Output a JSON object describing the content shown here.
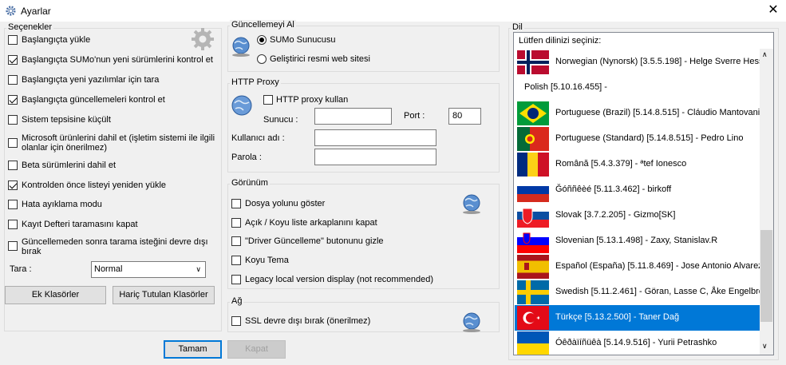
{
  "window": {
    "title": "Ayarlar",
    "close": "✕"
  },
  "options": {
    "label": "Seçenekler",
    "items": [
      {
        "text": "Başlangıçta yükle",
        "checked": false
      },
      {
        "text": "Başlangıçta SUMo'nun yeni sürümlerini kontrol et",
        "checked": true
      },
      {
        "text": "Başlangıçta yeni yazılımlar için tara",
        "checked": false
      },
      {
        "text": "Başlangıçta güncellemeleri kontrol et",
        "checked": true
      },
      {
        "text": "Sistem tepsisine küçült",
        "checked": false
      },
      {
        "text": "Microsoft ürünlerini dahil et (işletim sistemi ile ilgili",
        "text2": "olanlar için önerilmez)",
        "checked": false
      },
      {
        "text": "Beta sürümlerini dahil et",
        "checked": false
      },
      {
        "text": "Kontrolden önce listeyi yeniden yükle",
        "checked": true
      },
      {
        "text": "Hata ayıklama modu",
        "checked": false
      },
      {
        "text": "Kayıt Defteri taramasını kapat",
        "checked": false
      },
      {
        "text": "Güncellemeden sonra tarama isteğini devre dışı",
        "text2": "bırak",
        "checked": false
      }
    ],
    "scan_label": "Tara :",
    "scan_value": "Normal",
    "extra_folders_button": "Ek Klasörler",
    "excluded_folders_button": "Hariç Tutulan Klasörler"
  },
  "update_from": {
    "label": "Güncellemeyi Al",
    "radio1": "SUMo Sunucusu",
    "radio2": "Geliştirici resmi web sitesi"
  },
  "proxy": {
    "label": "HTTP Proxy",
    "use_label": "HTTP proxy kullan",
    "server_label": "Sunucu :",
    "server_value": "",
    "port_label": "Port :",
    "port_value": "80",
    "user_label": "Kullanıcı adı :",
    "user_value": "",
    "pass_label": "Parola :",
    "pass_value": ""
  },
  "appearance": {
    "label": "Görünüm",
    "items": [
      "Dosya yolunu göster",
      "Açık / Koyu liste arkaplanını kapat",
      "\"Driver Güncelleme\" butonunu gizle",
      "Koyu Tema",
      "Legacy local version display (not recommended)"
    ]
  },
  "network": {
    "label": "Ağ",
    "ssl": "SSL devre dışı bırak (önerilmez)"
  },
  "language": {
    "label": "Dil",
    "header": "Lütfen dilinizi seçiniz:",
    "items": [
      {
        "text": "Norwegian (Nynorsk) [3.5.5.198] - Helge Sverre Hessestrand",
        "flag": "norway"
      },
      {
        "text": "Polish [5.10.16.455] -",
        "flag": "none"
      },
      {
        "text": "Portuguese (Brazil) [5.14.8.515] - Cláudio Mantovani V",
        "flag": "brazil"
      },
      {
        "text": "Portuguese (Standard) [5.14.8.515] - Pedro Lino",
        "flag": "portugal"
      },
      {
        "text": "Română [5.4.3.379] - ªtef Ionesco",
        "flag": "romania"
      },
      {
        "text": "Ğóññêèé [5.11.3.462] - birkoff",
        "flag": "russia"
      },
      {
        "text": "Slovak [3.7.2.205] - Gizmo[SK]",
        "flag": "slovakia"
      },
      {
        "text": "Slovenian [5.13.1.498] - Zaxy, Stanislav.R",
        "flag": "slovenia"
      },
      {
        "text": "Español (España) [5.11.8.469] - Jose Antonio Alvarez Mor",
        "flag": "spain"
      },
      {
        "text": "Swedish [5.11.2.461] - Göran, Lasse C, Åke Engelbrektson",
        "flag": "sweden"
      },
      {
        "text": "Türkçe [5.13.2.500] - Taner Dağ",
        "flag": "turkey",
        "selected": true
      },
      {
        "text": "Óêðàїíñüêà [5.14.9.516] - Yurii Petrashko",
        "flag": "ukraine"
      }
    ]
  },
  "footer": {
    "ok": "Tamam",
    "close": "Kapat"
  },
  "icons": {
    "gear": "gear-icon",
    "globe": "globe-icon",
    "settings": "settings-app-icon"
  }
}
